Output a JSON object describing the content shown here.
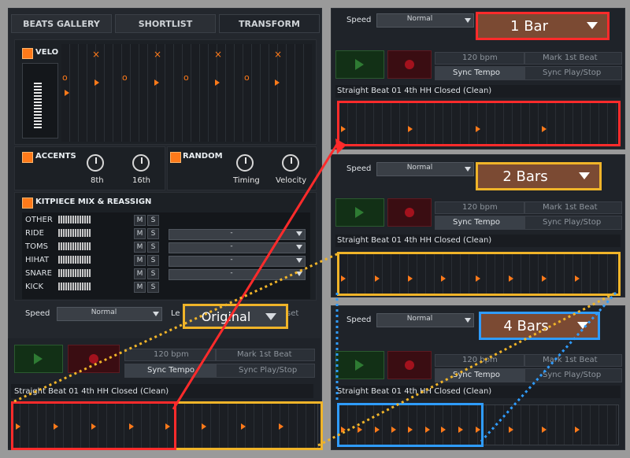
{
  "tabs": [
    "BEATS GALLERY",
    "SHORTLIST",
    "TRANSFORM"
  ],
  "velo": {
    "label": "VELO"
  },
  "accents": {
    "title": "ACCENTS",
    "knob1": "8th",
    "knob2": "16th"
  },
  "random": {
    "title": "RANDOM",
    "knob1": "Timing",
    "knob2": "Velocity"
  },
  "kitpiece": {
    "title": "KITPIECE MIX & REASSIGN",
    "rows": [
      {
        "label": "OTHER",
        "mute": "M",
        "solo": "S",
        "assign": ""
      },
      {
        "label": "RIDE",
        "mute": "M",
        "solo": "S",
        "assign": "-"
      },
      {
        "label": "TOMS",
        "mute": "M",
        "solo": "S",
        "assign": "-"
      },
      {
        "label": "HIHAT",
        "mute": "M",
        "solo": "S",
        "assign": "-"
      },
      {
        "label": "SNARE",
        "mute": "M",
        "solo": "S",
        "assign": "-"
      },
      {
        "label": "KICK",
        "mute": "M",
        "solo": "S",
        "assign": ""
      }
    ]
  },
  "bottom_controls": {
    "speed_label": "Speed",
    "speed_value": "Normal",
    "len_prefix": "Le",
    "reset_suffix": "set"
  },
  "transport_left": {
    "tempo": "120 bpm",
    "mark": "Mark 1st Beat",
    "sync_tempo": "Sync Tempo",
    "sync_play": "Sync Play/Stop",
    "beat_name": "Straight Beat 01 4th HH Closed (Clean)"
  },
  "big_dropdowns": {
    "original": "Original",
    "one_bar": "1 Bar",
    "two_bars": "2 Bars",
    "four_bars": "4 Bars"
  },
  "right_panels": [
    {
      "speed_label": "Speed",
      "speed_value": "Normal",
      "tempo": "120 bpm",
      "mark": "Mark 1st Beat",
      "sync_tempo": "Sync Tempo",
      "sync_play": "Sync Play/Stop",
      "beat_name": "Straight Beat 01 4th HH Closed (Clean)"
    },
    {
      "speed_label": "Speed",
      "speed_value": "Normal",
      "tempo": "120 bpm",
      "mark": "Mark 1st Beat",
      "sync_tempo": "Sync Tempo",
      "sync_play": "Sync Play/Stop",
      "beat_name": "Straight Beat 01 4th HH Closed (Clean)"
    },
    {
      "speed_label": "Speed",
      "speed_value": "Normal",
      "tempo": "120 bpm",
      "mark": "Mark 1st Beat",
      "sync_tempo": "Sync Tempo",
      "sync_play": "Sync Play/Stop",
      "beat_name": "Straight Beat 01 4th HH Closed (Clean)"
    }
  ],
  "colors": {
    "accent_orange": "#ff7a1a",
    "highlight_red": "#ff2b2b",
    "highlight_yellow": "#f0b429",
    "highlight_blue": "#2f9cff"
  }
}
